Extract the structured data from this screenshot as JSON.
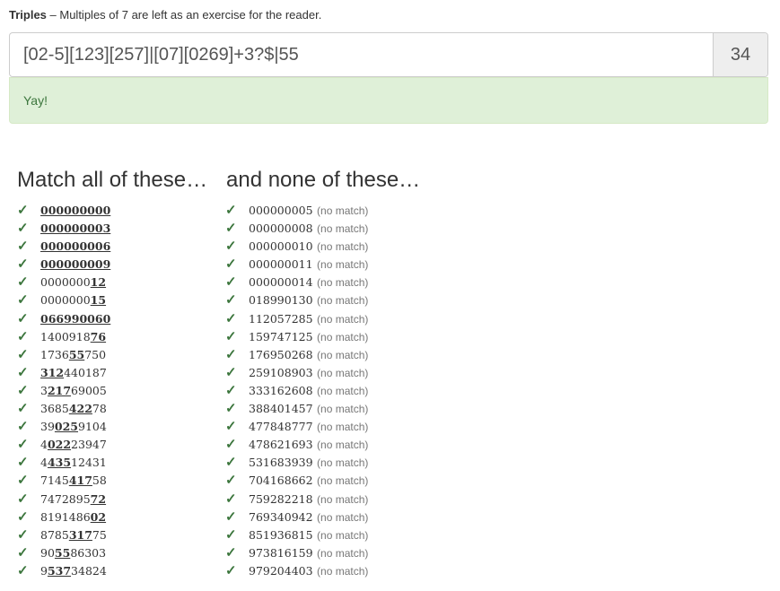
{
  "header": {
    "title": "Triples",
    "subtitle": " – Multiples of 7 are left as an exercise for the reader."
  },
  "regex": {
    "value": "[02-5][123][257]|[07][0269]+3?$|55",
    "score": "34"
  },
  "alert": {
    "message": "Yay!"
  },
  "match_heading": "Match all of these…",
  "nomatch_heading": "and none of these…",
  "check_symbol": "✓",
  "no_match_label": "(no match)",
  "colors": {
    "success_text": "#3c763d",
    "success_bg": "#dff0d8",
    "muted": "#777777"
  },
  "matches": [
    {
      "pre": "",
      "match": "000000000",
      "post": ""
    },
    {
      "pre": "",
      "match": "000000003",
      "post": ""
    },
    {
      "pre": "",
      "match": "000000006",
      "post": ""
    },
    {
      "pre": "",
      "match": "000000009",
      "post": ""
    },
    {
      "pre": "0000000",
      "match": "12",
      "post": ""
    },
    {
      "pre": "0000000",
      "match": "15",
      "post": ""
    },
    {
      "pre": "",
      "match": "066990060",
      "post": ""
    },
    {
      "pre": "1400918",
      "match": "76",
      "post": ""
    },
    {
      "pre": "1736",
      "match": "55",
      "post": "750"
    },
    {
      "pre": "",
      "match": "312",
      "post": "440187"
    },
    {
      "pre": "3",
      "match": "217",
      "post": "69005"
    },
    {
      "pre": "3685",
      "match": "422",
      "post": "78"
    },
    {
      "pre": "39",
      "match": "025",
      "post": "9104"
    },
    {
      "pre": "4",
      "match": "022",
      "post": "23947"
    },
    {
      "pre": "4",
      "match": "435",
      "post": "12431"
    },
    {
      "pre": "7145",
      "match": "417",
      "post": "58"
    },
    {
      "pre": "7472895",
      "match": "72",
      "post": ""
    },
    {
      "pre": "8191486",
      "match": "02",
      "post": ""
    },
    {
      "pre": "8785",
      "match": "317",
      "post": "75"
    },
    {
      "pre": "90",
      "match": "55",
      "post": "86303"
    },
    {
      "pre": "9",
      "match": "537",
      "post": "34824"
    }
  ],
  "nonmatches": [
    "000000005",
    "000000008",
    "000000010",
    "000000011",
    "000000014",
    "018990130",
    "112057285",
    "159747125",
    "176950268",
    "259108903",
    "333162608",
    "388401457",
    "477848777",
    "478621693",
    "531683939",
    "704168662",
    "759282218",
    "769340942",
    "851936815",
    "973816159",
    "979204403"
  ]
}
